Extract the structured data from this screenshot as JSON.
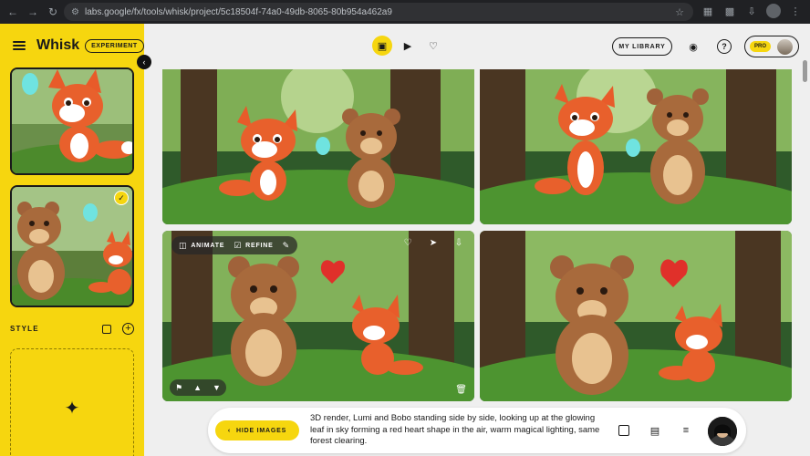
{
  "browser": {
    "url": "labs.google/fx/tools/whisk/project/5c18504f-74a0-49db-8065-80b954a462a9"
  },
  "sidebar": {
    "brand": "Whisk",
    "badge": "EXPERIMENT",
    "style_label": "STYLE"
  },
  "topbar": {
    "library_label": "MY LIBRARY",
    "plan_badge": "PRO"
  },
  "image_actions": {
    "animate_label": "ANIMATE",
    "refine_label": "REFINE"
  },
  "prompt": {
    "hide_label": "HIDE IMAGES",
    "text": "3D render, Lumi and Bobo standing side by side, looking up at the glowing leaf in sky forming a red heart shape in the air, warm magical lighting, same forest clearing."
  },
  "colors": {
    "accent": "#f6d60f",
    "chrome": "#202124",
    "canvas": "#efefef"
  },
  "icons": {
    "mode": [
      "image-add-icon",
      "video-icon",
      "heart-icon"
    ],
    "hover_top": [
      "heart-icon",
      "share-icon",
      "download-icon"
    ],
    "hover_bottom": [
      "flag-icon",
      "thumbs-up-icon",
      "thumbs-down-icon"
    ]
  }
}
